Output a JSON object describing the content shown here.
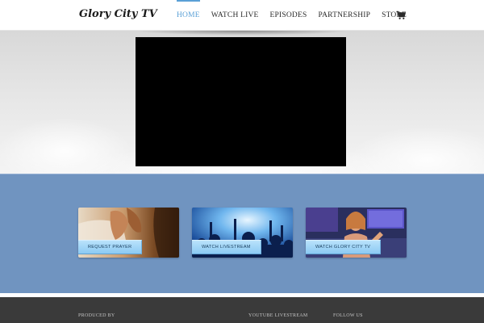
{
  "header": {
    "logo": "Glory City TV",
    "nav": [
      {
        "label": "HOME",
        "active": true
      },
      {
        "label": "WATCH LIVE",
        "active": false
      },
      {
        "label": "EPISODES",
        "active": false
      },
      {
        "label": "PARTNERSHIP",
        "active": false
      },
      {
        "label": "STORE",
        "active": false
      }
    ],
    "cart_icon": "shopping-cart-icon"
  },
  "colors": {
    "accent": "#5aa0d6",
    "band": "#7094c0",
    "footer": "#3a3a3a",
    "button": "#a5d7f8"
  },
  "cards": [
    {
      "label": "REQUEST PRAYER",
      "image": "praying-hands-bible-photo"
    },
    {
      "label": "WATCH LIVESTREAM",
      "image": "concert-crowd-photo"
    },
    {
      "label": "WATCH GLORY CITY TV",
      "image": "tv-studio-host-photo"
    }
  ],
  "footer": {
    "produced_by": "PRODUCED BY",
    "youtube": "YOUTUBE LIVESTREAM",
    "follow": "FOLLOW US"
  }
}
